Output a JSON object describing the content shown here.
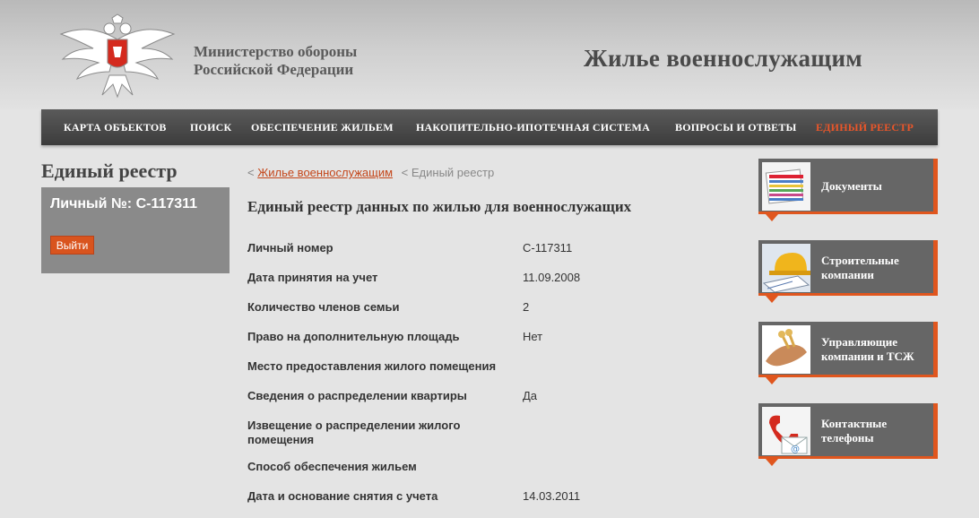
{
  "header": {
    "ministry_line1": "Министерство обороны",
    "ministry_line2": "Российской Федерации",
    "site_title": "Жилье военнослужащим"
  },
  "nav": {
    "items": [
      {
        "label": "КАРТА ОБЪЕКТОВ"
      },
      {
        "label": "ПОИСК"
      },
      {
        "label": "ОБЕСПЕЧЕНИЕ ЖИЛЬЕМ"
      },
      {
        "label": "НАКОПИТЕЛЬНО-ИПОТЕЧНАЯ СИСТЕМА"
      },
      {
        "label": "ВОПРОСЫ И ОТВЕТЫ"
      },
      {
        "label": "ЕДИНЫЙ РЕЕСТР",
        "active": true
      }
    ]
  },
  "left": {
    "title": "Единый реестр",
    "personal_number": "Личный №: С-117311",
    "logout": "Выйти"
  },
  "breadcrumb": {
    "sep1": "<",
    "link": "Жилье военнослужащим",
    "sep2": "<",
    "current": "Единый реестр"
  },
  "main": {
    "title": "Единый реестр данных по жилью для военнослужащих",
    "rows": [
      {
        "label": "Личный номер",
        "value": "С-117311"
      },
      {
        "label": "Дата принятия на учет",
        "value": "11.09.2008"
      },
      {
        "label": "Количество членов семьи",
        "value": "2"
      },
      {
        "label": "Право на дополнительную площадь",
        "value": "Нет"
      },
      {
        "label": "Место предоставления жилого помещения",
        "value": ""
      },
      {
        "label": "Сведения о распределении квартиры",
        "value": "Да"
      },
      {
        "label": "Извещение о распределении жилого помещения",
        "value": ""
      },
      {
        "label": "Способ обеспечения жильем",
        "value": ""
      },
      {
        "label": "Дата и основание снятия с учета",
        "value": "14.03.2011"
      }
    ]
  },
  "sidebar": {
    "items": [
      {
        "label": "Документы",
        "icon": "documents-icon"
      },
      {
        "label": "Строительные компании",
        "icon": "construction-icon"
      },
      {
        "label": "Управляющие компании и ТСЖ",
        "icon": "keys-icon"
      },
      {
        "label": "Контактные телефоны",
        "icon": "phone-icon"
      }
    ]
  },
  "colors": {
    "accent": "#e0561e",
    "nav_bg": "#444444",
    "panel_bg": "#666666"
  }
}
